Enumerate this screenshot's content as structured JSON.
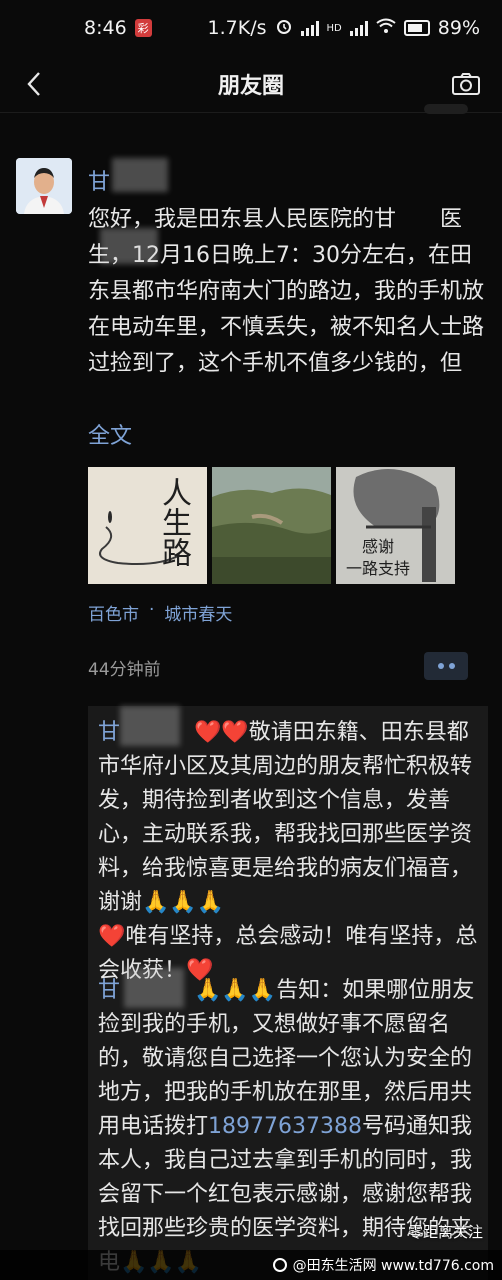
{
  "status_bar": {
    "time": "8:46",
    "notif": "彩",
    "speed": "1.7K/s",
    "signal_label": "HD",
    "battery": "89%"
  },
  "nav": {
    "title": "朋友圈",
    "back_icon": "chevron-left-icon",
    "camera_icon": "camera-icon"
  },
  "post": {
    "author": "甘",
    "text": "您好，我是田东县人民医院的甘　　医生，12月16日晚上7：30分左右，在田东县都市华府南大门的路边，我的手机放在电动车里，不慎丢失，被不知名人士路过捡到了，这个手机不值多少钱的，但",
    "full_text_label": "全文",
    "images": [
      {
        "caption": "人生路"
      },
      {
        "caption": ""
      },
      {
        "caption_line1": "感谢",
        "caption_line2": "一路支持"
      }
    ],
    "location_city": "百色市",
    "location_dot": "·",
    "location_place": "城市春天",
    "time_ago": "44分钟前"
  },
  "comments": [
    {
      "author": "甘",
      "text": "❤️❤️敬请田东籍、田东县都市华府小区及其周边的朋友帮忙积极转发，期待捡到者收到这个信息，发善心，主动联系我，帮我找回那些医学资料，给我惊喜更是给我的病友们福音，谢谢🙏🙏🙏\n❤️唯有坚持，总会感动！唯有坚持，总会收获！❤️"
    },
    {
      "author": "甘",
      "text_before": "🙏🙏🙏告知：如果哪位朋友捡到我的手机，又想做好事不愿留名的，敬请您自己选择一个您认为安全的地方，把我的手机放在那里，然后用共用电话拨打",
      "phone": "18977637388",
      "text_after": "号码通知我本人，我自己过去拿到手机的同时，我会留下一个红包表示感谢，感谢您帮我找回那些珍贵的医学资料，期待您的来电🙏🙏🙏"
    }
  ],
  "watermark": {
    "line1": "零距离关注",
    "line2": "@田东生活网 www.td776.com"
  },
  "colors": {
    "link": "#7fa3d6",
    "background": "#0a0a0a",
    "comment_bg": "#1a1a1a"
  }
}
